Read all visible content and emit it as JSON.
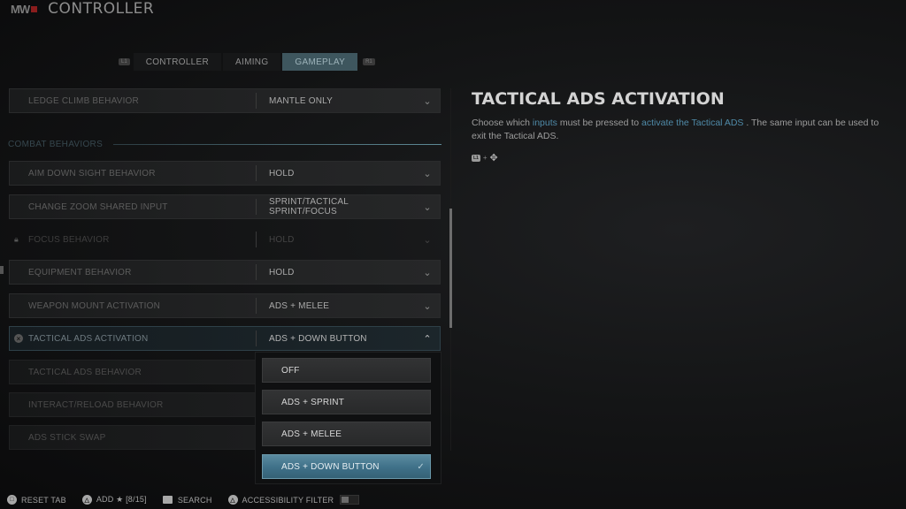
{
  "header": {
    "logo": "MW",
    "title": "CONTROLLER"
  },
  "tabs": {
    "left_bumper": "L1",
    "right_bumper": "R1",
    "items": [
      {
        "label": "CONTROLLER",
        "active": false
      },
      {
        "label": "AIMING",
        "active": false
      },
      {
        "label": "GAMEPLAY",
        "active": true
      }
    ]
  },
  "settings": {
    "ledge_climb": {
      "label": "LEDGE CLIMB BEHAVIOR",
      "value": "MANTLE ONLY"
    },
    "section_title": "COMBAT BEHAVIORS",
    "rows": [
      {
        "label": "AIM DOWN SIGHT BEHAVIOR",
        "value": "HOLD",
        "state": "normal"
      },
      {
        "label": "CHANGE ZOOM SHARED INPUT",
        "value": "SPRINT/TACTICAL SPRINT/FOCUS",
        "state": "normal"
      },
      {
        "label": "FOCUS BEHAVIOR",
        "value": "HOLD",
        "state": "locked"
      },
      {
        "label": "EQUIPMENT BEHAVIOR",
        "value": "HOLD",
        "state": "normal"
      },
      {
        "label": "WEAPON MOUNT ACTIVATION",
        "value": "ADS + MELEE",
        "state": "normal"
      },
      {
        "label": "TACTICAL ADS ACTIVATION",
        "value": "ADS + DOWN BUTTON",
        "state": "expanded"
      },
      {
        "label": "TACTICAL ADS BEHAVIOR",
        "value": "",
        "state": "obscured"
      },
      {
        "label": "INTERACT/RELOAD BEHAVIOR",
        "value": "",
        "state": "obscured"
      },
      {
        "label": "ADS STICK SWAP",
        "value": "",
        "state": "obscured"
      }
    ]
  },
  "dropdown": {
    "options": [
      {
        "label": "OFF",
        "selected": false
      },
      {
        "label": "ADS + SPRINT",
        "selected": false
      },
      {
        "label": "ADS + MELEE",
        "selected": false
      },
      {
        "label": "ADS + DOWN BUTTON",
        "selected": true
      }
    ]
  },
  "detail": {
    "title": "TACTICAL ADS ACTIVATION",
    "desc_part1": "Choose which ",
    "desc_hl1": "inputs",
    "desc_part2": " must be pressed to ",
    "desc_hl2": "activate the Tactical ADS",
    "desc_part3": " . The same input can be used to exit the Tactical ADS.",
    "combo_button": "L1",
    "combo_plus": "+",
    "highlight_color": "#4f8aa8"
  },
  "footer": {
    "reset": "RESET TAB",
    "add": "ADD ★ [8/15]",
    "search": "SEARCH",
    "accessibility": "ACCESSIBILITY FILTER",
    "accessibility_on": false
  }
}
